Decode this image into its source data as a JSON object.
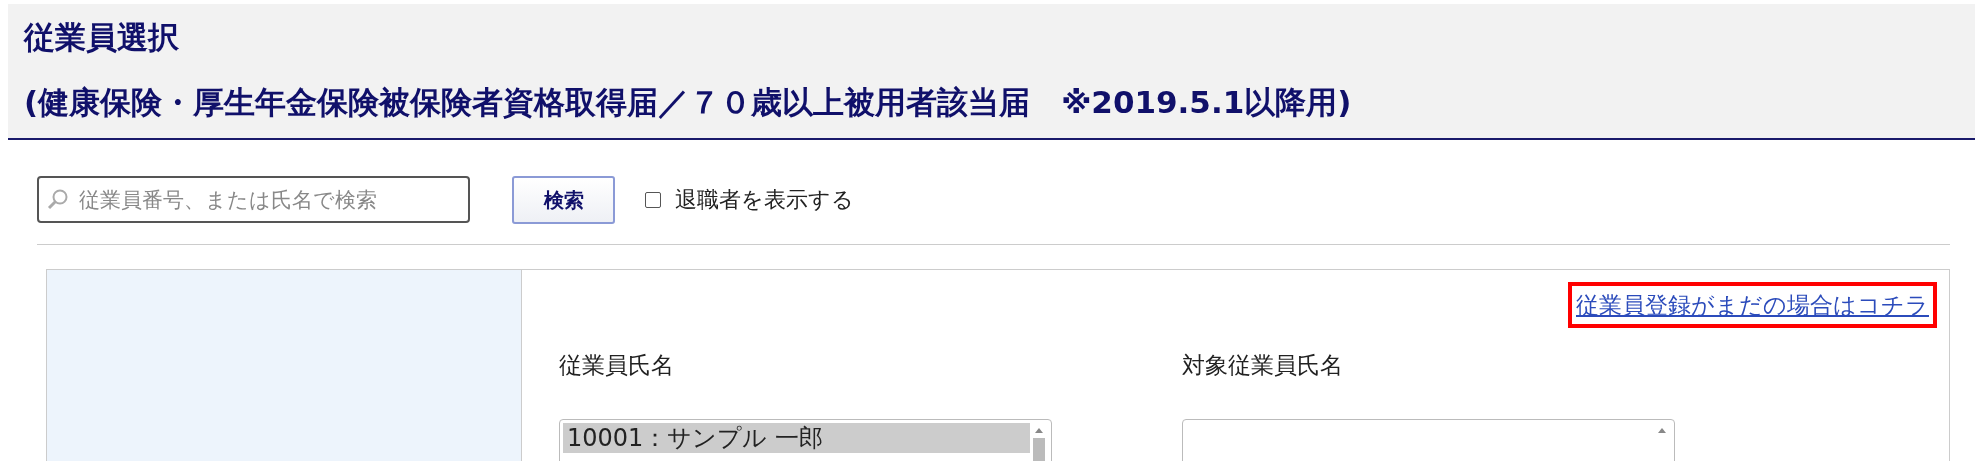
{
  "header": {
    "title": "従業員選択",
    "subtitle": "(健康保険・厚生年金保険被保険者資格取得届／７０歳以上被用者該当届　※2019.5.1以降用)"
  },
  "search": {
    "placeholder": "従業員番号、または氏名で検索",
    "button": "検索",
    "retired_checkbox": {
      "label": "退職者を表示する",
      "checked": false
    }
  },
  "panel": {
    "register_link": {
      "label": "従業員登録がまだの場合はコチラ",
      "highlighted": true
    },
    "employee_list": {
      "label": "従業員氏名",
      "items": [
        {
          "label": "10001：サンプル 一郎",
          "selected": true
        }
      ]
    },
    "target_list": {
      "label": "対象従業員氏名"
    }
  }
}
